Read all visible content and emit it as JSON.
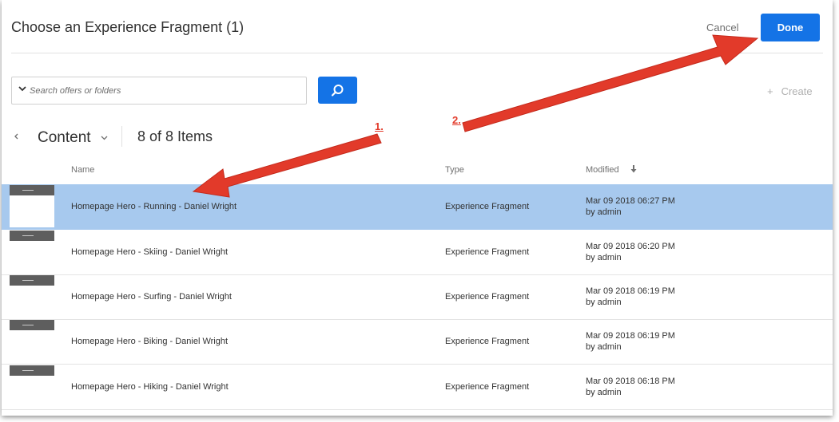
{
  "dialog": {
    "title": "Choose an Experience Fragment (1)",
    "cancel_label": "Cancel",
    "done_label": "Done"
  },
  "search": {
    "placeholder": "Search offers or folders"
  },
  "toolbar": {
    "create_label": "Create"
  },
  "breadcrumb": {
    "label": "Content",
    "count": "8 of 8 Items"
  },
  "table": {
    "columns": {
      "name": "Name",
      "type": "Type",
      "modified": "Modified"
    },
    "rows": [
      {
        "name": "Homepage Hero - Running - Daniel Wright",
        "type": "Experience Fragment",
        "modified": "Mar 09 2018  06:27 PM",
        "by": "by admin",
        "selected": true
      },
      {
        "name": "Homepage Hero - Skiing - Daniel Wright",
        "type": "Experience Fragment",
        "modified": "Mar 09 2018  06:20 PM",
        "by": "by admin",
        "selected": false
      },
      {
        "name": "Homepage Hero - Surfing - Daniel Wright",
        "type": "Experience Fragment",
        "modified": "Mar 09 2018  06:19 PM",
        "by": "by admin",
        "selected": false
      },
      {
        "name": "Homepage Hero - Biking - Daniel Wright",
        "type": "Experience Fragment",
        "modified": "Mar 09 2018  06:19 PM",
        "by": "by admin",
        "selected": false
      },
      {
        "name": "Homepage Hero - Hiking - Daniel Wright",
        "type": "Experience Fragment",
        "modified": "Mar 09 2018  06:18 PM",
        "by": "by admin",
        "selected": false
      }
    ]
  },
  "annotations": {
    "step1": "1.",
    "step2": "2."
  },
  "colors": {
    "accent": "#1473e6",
    "selected_row": "#a7c9ee",
    "annotation": "#e23a2a"
  }
}
